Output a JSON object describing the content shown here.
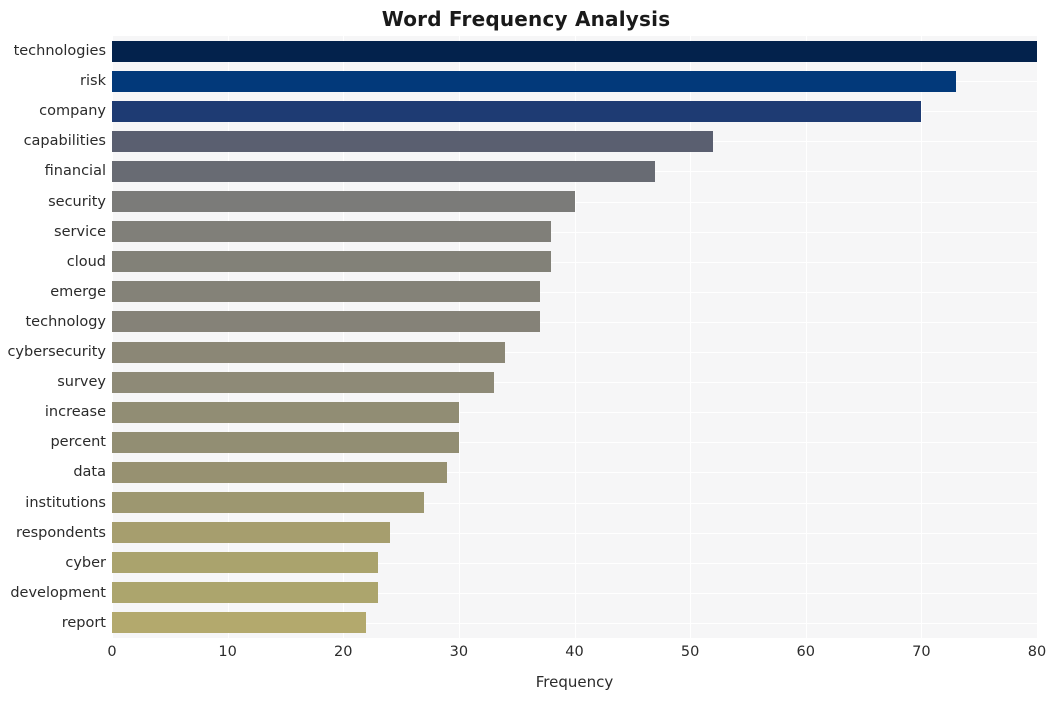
{
  "chart_data": {
    "type": "bar",
    "orientation": "horizontal",
    "title": "Word Frequency Analysis",
    "xlabel": "Frequency",
    "ylabel": "",
    "categories": [
      "technologies",
      "risk",
      "company",
      "capabilities",
      "financial",
      "security",
      "service",
      "cloud",
      "emerge",
      "technology",
      "cybersecurity",
      "survey",
      "increase",
      "percent",
      "data",
      "institutions",
      "respondents",
      "cyber",
      "development",
      "report"
    ],
    "values": [
      80,
      73,
      70,
      52,
      47,
      40,
      38,
      38,
      37,
      37,
      34,
      33,
      30,
      30,
      29,
      27,
      24,
      23,
      23,
      22
    ],
    "bar_colors": [
      "#03224c",
      "#02397a",
      "#1e3b73",
      "#5a5f70",
      "#686b73",
      "#7b7b79",
      "#807f79",
      "#828178",
      "#848278",
      "#858278",
      "#8b8776",
      "#8e8a77",
      "#918d74",
      "#928e73",
      "#979171",
      "#9d9770",
      "#a69e6e",
      "#aaa36d",
      "#aca56d",
      "#b3a96d"
    ],
    "xlim": [
      0,
      80
    ],
    "xticks": [
      0,
      10,
      20,
      30,
      40,
      50,
      60,
      70,
      80
    ],
    "xtick_labels": [
      "0",
      "10",
      "20",
      "30",
      "40",
      "50",
      "60",
      "70",
      "80"
    ],
    "grid": true,
    "grid_color": "#ffffff",
    "plot_background": "#f6f6f7",
    "figure_background": "#ffffff",
    "legend": null,
    "legend_position": "none"
  }
}
